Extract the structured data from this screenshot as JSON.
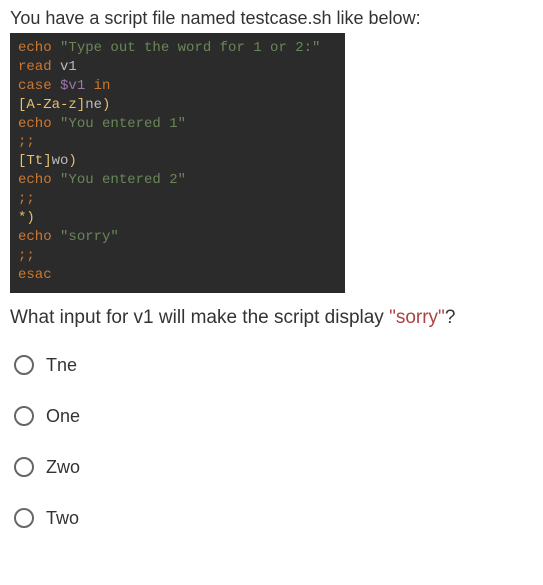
{
  "intro": "You have a script file named testcase.sh like below:",
  "code": {
    "l1a": "echo ",
    "l1b": "\"Type out the word for 1 or 2:\"",
    "l2a": "read ",
    "l2b": "v1",
    "l3a": "case ",
    "l3b": "$v1",
    "l3c": " in",
    "l4a": "[A-Za-z]",
    "l4b": "ne",
    "l4c": ")",
    "l5a": "echo ",
    "l5b": "\"You entered 1\"",
    "l6": ";;",
    "l7a": "[Tt]",
    "l7b": "wo",
    "l7c": ")",
    "l8a": "echo ",
    "l8b": "\"You entered 2\"",
    "l9": ";;",
    "l10a": "*",
    "l10b": ")",
    "l11a": "echo ",
    "l11b": "\"sorry\"",
    "l12": ";;",
    "l13": "esac"
  },
  "question_prefix": "What input for v1 will make the script display ",
  "question_sorry": "\"sorry\"",
  "question_suffix": "?",
  "options": [
    "Tne",
    "One",
    "Zwo",
    "Two"
  ]
}
